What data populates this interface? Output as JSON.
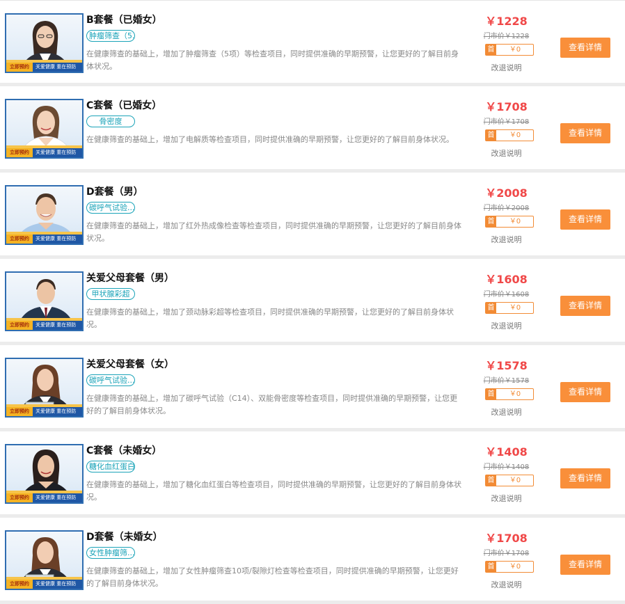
{
  "common": {
    "cta_label": "查看详情",
    "refund_label": "改退说明",
    "first_order_mark": "首",
    "banner_tag": "立即预约",
    "banner_slogan": "关爱健康  重在预防"
  },
  "accent": "#f98f3a",
  "price_color": "#f04848",
  "packages": [
    {
      "title": "B套餐（已婚女）",
      "tag": "肿瘤筛查（5...",
      "description": "在健康筛查的基础上，增加了肿瘤筛查（5项）等检查项目，同时提供准确的早期预警，让您更好的了解目前身体状况。",
      "price": "￥1228",
      "market_price": "门市价￥1228",
      "first_discount": "￥0",
      "photo": "woman-with-glasses"
    },
    {
      "title": "C套餐（已婚女）",
      "tag": "骨密度",
      "description": "在健康筛查的基础上，增加了电解质等检查项目，同时提供准确的早期预警，让您更好的了解目前身体状况。",
      "price": "￥1708",
      "market_price": "门市价￥1708",
      "first_discount": "￥0",
      "photo": "smiling-woman"
    },
    {
      "title": "D套餐（男）",
      "tag": "碳呼气试验...",
      "description": "在健康筛查的基础上，增加了红外热成像检查等检查项目，同时提供准确的早期预警，让您更好的了解目前身体状况。",
      "price": "￥2008",
      "market_price": "门市价￥2008",
      "first_discount": "￥0",
      "photo": "man-blue-shirt"
    },
    {
      "title": "关爱父母套餐（男）",
      "tag": "甲状腺彩超",
      "description": "在健康筛查的基础上，增加了颈动脉彩超等检查项目，同时提供准确的早期预警，让您更好的了解目前身体状况。",
      "price": "￥1608",
      "market_price": "门市价￥1608",
      "first_discount": "￥0",
      "photo": "man-in-suit"
    },
    {
      "title": "关爱父母套餐（女）",
      "tag": "碳呼气试验...",
      "description": "在健康筛查的基础上，增加了碳呼气试验（C14）、双能骨密度等检查项目，同时提供准确的早期预警，让您更好的了解目前身体状况。",
      "price": "￥1578",
      "market_price": "门市价￥1578",
      "first_discount": "￥0",
      "photo": "woman-with-laptop"
    },
    {
      "title": "C套餐（未婚女）",
      "tag": "糖化血红蛋白",
      "description": "在健康筛查的基础上，增加了糖化血红蛋白等检查项目，同时提供准确的早期预警，让您更好的了解目前身体状况。",
      "price": "￥1408",
      "market_price": "门市价￥1408",
      "first_discount": "￥0",
      "photo": "dark-haired-woman"
    },
    {
      "title": "D套餐（未婚女）",
      "tag": "女性肿瘤筛...",
      "description": "在健康筛查的基础上，增加了女性肿瘤筛查10项/裂隙灯检查等检查项目，同时提供准确的早期预警，让您更好的了解目前身体状况。",
      "price": "￥1708",
      "market_price": "门市价￥1708",
      "first_discount": "￥0",
      "photo": "woman-with-laptop"
    }
  ]
}
